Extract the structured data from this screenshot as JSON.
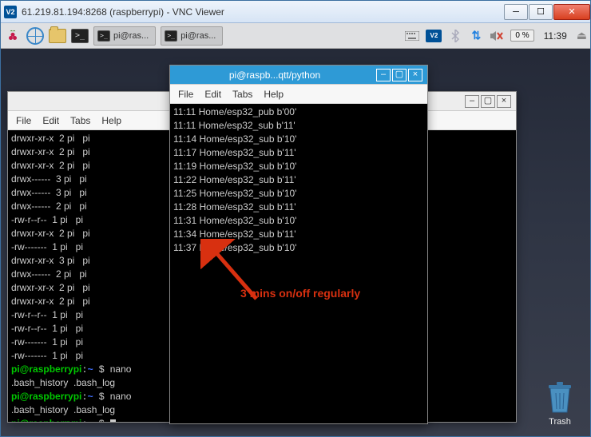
{
  "vnc": {
    "title": "61.219.81.194:8268 (raspberrypi) - VNC Viewer",
    "icon_label": "V2"
  },
  "panel": {
    "tasks": [
      {
        "label": "pi@ras..."
      },
      {
        "label": "pi@ras..."
      }
    ],
    "cpu_pct": "0 %",
    "clock": "11:39"
  },
  "back_terminal": {
    "menu": [
      "File",
      "Edit",
      "Tabs",
      "Help"
    ],
    "lines": [
      "drwxr-xr-x  2 pi   pi",
      "drwxr-xr-x  2 pi   pi",
      "drwxr-xr-x  2 pi   pi",
      "drwx------  3 pi   pi",
      "drwx------  3 pi   pi",
      "drwx------  2 pi   pi",
      "-rw-r--r--  1 pi   pi",
      "drwxr-xr-x  2 pi   pi",
      "-rw-------  1 pi   pi",
      "drwxr-xr-x  3 pi   pi",
      "drwx------  2 pi   pi",
      "drwxr-xr-x  2 pi   pi",
      "drwxr-xr-x  2 pi   pi",
      "-rw-r--r--  1 pi   pi",
      "-rw-r--r--  1 pi   pi",
      "-rw-------  1 pi   pi",
      "-rw-------  1 pi   pi"
    ],
    "prompt_user": "pi@raspberrypi",
    "prompt_path": "~",
    "prompt_symbol": "$",
    "cmd_nano": "nano",
    "listing1": ".bash_history  .bash_log",
    "listing2": ".bash_history  .bash_log"
  },
  "front_terminal": {
    "title": "pi@raspb...qtt/python",
    "menu": [
      "File",
      "Edit",
      "Tabs",
      "Help"
    ],
    "lines": [
      "11:11 Home/esp32_pub b'00'",
      "11:11 Home/esp32_sub b'11'",
      "11:14 Home/esp32_sub b'10'",
      "11:17 Home/esp32_sub b'11'",
      "11:19 Home/esp32_sub b'10'",
      "11:22 Home/esp32_sub b'11'",
      "11:25 Home/esp32_sub b'10'",
      "11:28 Home/esp32_sub b'11'",
      "11:31 Home/esp32_sub b'10'",
      "11:34 Home/esp32_sub b'11'",
      "11:37 Home/esp32_sub b'10'"
    ]
  },
  "annotation": {
    "text": "3 mins on/off regularly"
  },
  "trash": {
    "label": "Trash"
  }
}
